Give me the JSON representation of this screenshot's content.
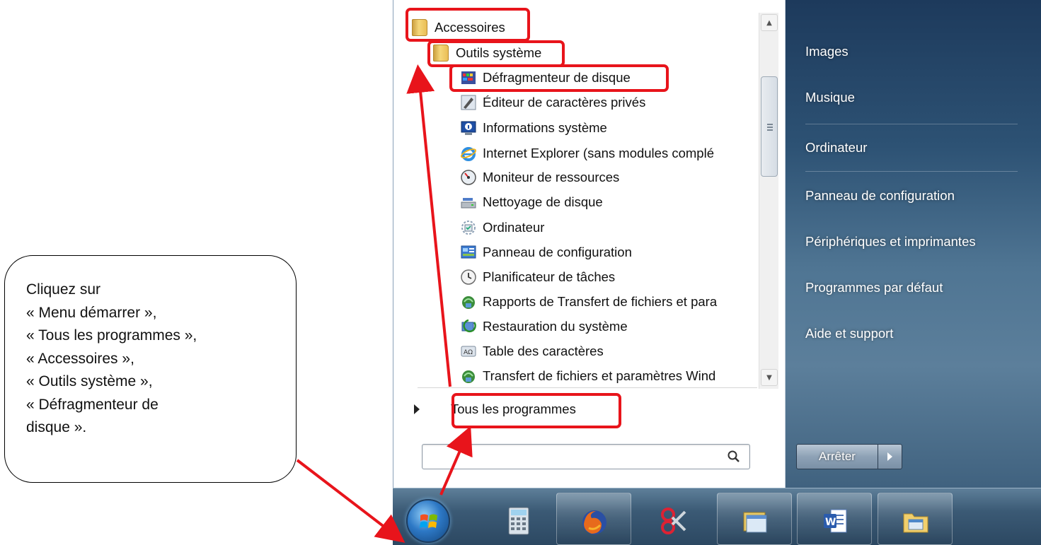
{
  "callout": {
    "lines": [
      "Cliquez sur",
      "« Menu démarrer »,",
      "« Tous les programmes »,",
      "« Accessoires »,",
      "« Outils système »,",
      "« Défragmenteur de",
      "disque »."
    ]
  },
  "start_menu": {
    "programs": {
      "folder_accessoires": "Accessoires",
      "folder_outils": "Outils système",
      "items": [
        {
          "label": "Défragmenteur de disque",
          "icon": "defrag-icon"
        },
        {
          "label": "Éditeur de caractères privés",
          "icon": "char-editor-icon"
        },
        {
          "label": "Informations système",
          "icon": "system-info-icon"
        },
        {
          "label": "Internet Explorer (sans modules complé",
          "icon": "internet-explorer-icon"
        },
        {
          "label": "Moniteur de ressources",
          "icon": "resource-monitor-icon"
        },
        {
          "label": "Nettoyage de disque",
          "icon": "disk-cleanup-icon"
        },
        {
          "label": "Ordinateur",
          "icon": "computer-icon"
        },
        {
          "label": "Panneau de configuration",
          "icon": "control-panel-icon"
        },
        {
          "label": "Planificateur de tâches",
          "icon": "task-scheduler-icon"
        },
        {
          "label": "Rapports de Transfert de fichiers et para",
          "icon": "transfer-reports-icon"
        },
        {
          "label": "Restauration du système",
          "icon": "system-restore-icon"
        },
        {
          "label": "Table des caractères",
          "icon": "character-map-icon"
        },
        {
          "label": "Transfert de fichiers et paramètres Wind",
          "icon": "easy-transfer-icon"
        }
      ],
      "all_programs": "Tous les programmes"
    },
    "search": {
      "value": "",
      "placeholder": ""
    },
    "right_items": [
      "Images",
      "Musique",
      "Ordinateur",
      "Panneau de configuration",
      "Périphériques et imprimantes",
      "Programmes par défaut",
      "Aide et support"
    ],
    "shutdown_label": "Arrêter"
  },
  "taskbar": {
    "pinned": [
      "calculator-icon",
      "firefox-icon",
      "snipping-tool-icon",
      "explorer-window-icon",
      "word-icon",
      "folder-library-icon"
    ]
  },
  "colors": {
    "highlight": "#e8141b",
    "right_pane": "#2d5274",
    "taskbar": "#3b5a75"
  }
}
